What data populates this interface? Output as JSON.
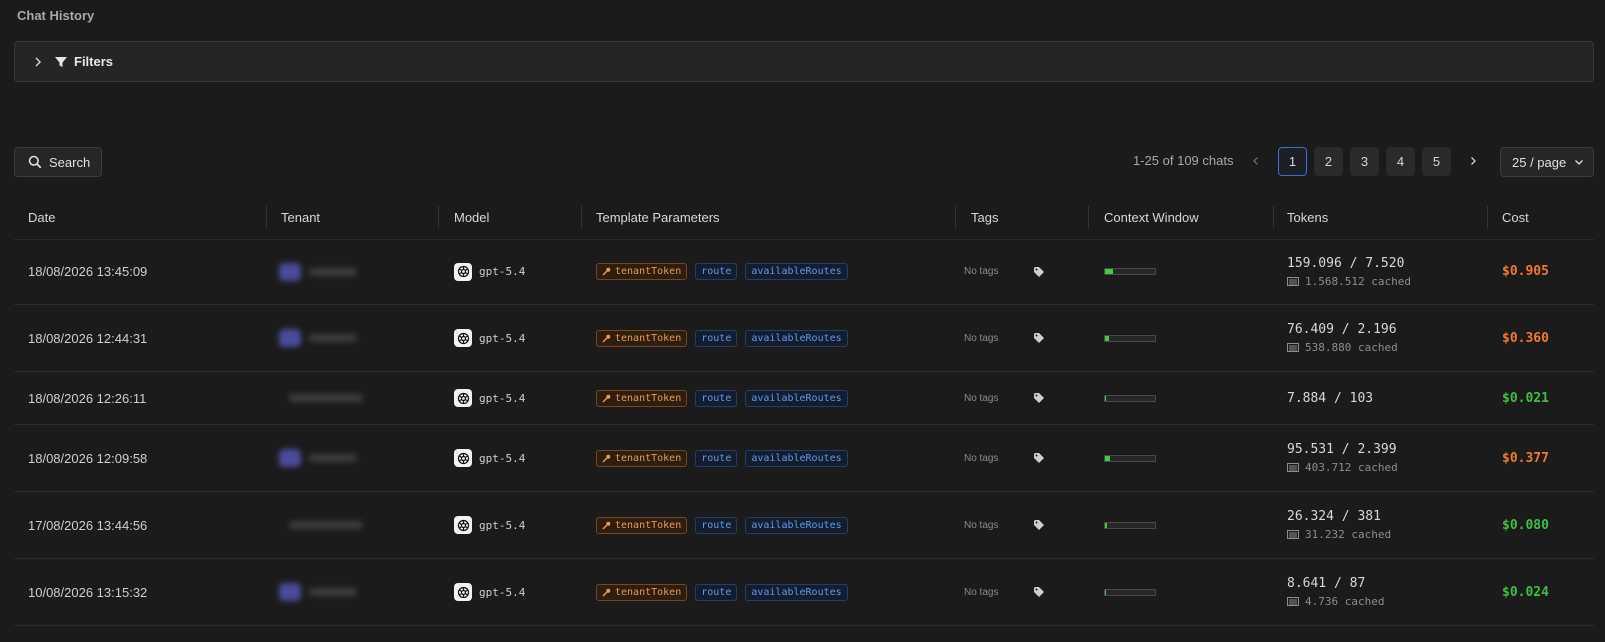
{
  "title": "Chat History",
  "filters": {
    "label": "Filters"
  },
  "search": {
    "label": "Search"
  },
  "pagination": {
    "summary": "1-25 of 109 chats",
    "pages": [
      "1",
      "2",
      "3",
      "4",
      "5"
    ],
    "active_page": "1",
    "page_size": "25 / page"
  },
  "table": {
    "columns": [
      "Date",
      "Tenant",
      "Model",
      "Template Parameters",
      "Tags",
      "Context Window",
      "Tokens",
      "Cost"
    ],
    "rows": [
      {
        "date": "18/08/2026 13:45:09",
        "model": "gpt-5.4",
        "params": [
          "tenantToken",
          "route",
          "availableRoutes"
        ],
        "tags": "No tags",
        "context_fill": 0.15,
        "tokens": "159.096 / 7.520",
        "cached": "1.568.512 cached",
        "cost": "$0.905",
        "cost_color": "#f07a2a"
      },
      {
        "date": "18/08/2026 12:44:31",
        "model": "gpt-5.4",
        "params": [
          "tenantToken",
          "route",
          "availableRoutes"
        ],
        "tags": "No tags",
        "context_fill": 0.08,
        "tokens": "76.409 / 2.196",
        "cached": "538.880 cached",
        "cost": "$0.360",
        "cost_color": "#f07a2a"
      },
      {
        "date": "18/08/2026 12:26:11",
        "model": "gpt-5.4",
        "params": [
          "tenantToken",
          "route",
          "availableRoutes"
        ],
        "tags": "No tags",
        "context_fill": 0.02,
        "tokens": "7.884 / 103",
        "cached": "",
        "cost": "$0.021",
        "cost_color": "#3fbf3f"
      },
      {
        "date": "18/08/2026 12:09:58",
        "model": "gpt-5.4",
        "params": [
          "tenantToken",
          "route",
          "availableRoutes"
        ],
        "tags": "No tags",
        "context_fill": 0.1,
        "tokens": "95.531 / 2.399",
        "cached": "403.712 cached",
        "cost": "$0.377",
        "cost_color": "#f07a2a"
      },
      {
        "date": "17/08/2026 13:44:56",
        "model": "gpt-5.4",
        "params": [
          "tenantToken",
          "route",
          "availableRoutes"
        ],
        "tags": "No tags",
        "context_fill": 0.03,
        "tokens": "26.324 / 381",
        "cached": "31.232 cached",
        "cost": "$0.080",
        "cost_color": "#3fbf3f"
      },
      {
        "date": "10/08/2026 13:15:32",
        "model": "gpt-5.4",
        "params": [
          "tenantToken",
          "route",
          "availableRoutes"
        ],
        "tags": "No tags",
        "context_fill": 0.02,
        "tokens": "8.641 / 87",
        "cached": "4.736 cached",
        "cost": "$0.024",
        "cost_color": "#3fbf3f"
      }
    ]
  },
  "colors": {
    "accent": "#3b6fd1",
    "cost_high": "#f07a2a",
    "cost_low": "#3fbf3f",
    "context_fill": "#3ccf3c"
  },
  "icons": [
    "chevron-right-icon",
    "filter-icon",
    "search-icon",
    "openai-icon",
    "key-icon",
    "tag-icon",
    "database-icon",
    "chevron-down-icon"
  ]
}
